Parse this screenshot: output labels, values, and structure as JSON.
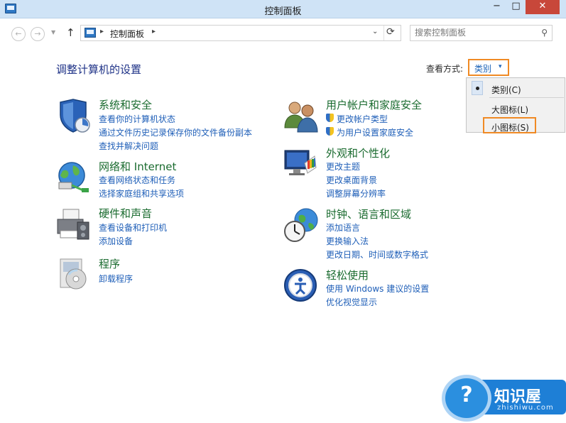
{
  "window": {
    "title": "控制面板",
    "minimize": "−",
    "maximize": "□",
    "close": "✕"
  },
  "nav": {
    "back": "←",
    "forward": "→",
    "recent": "▼",
    "up": "↑",
    "breadcrumb": "控制面板",
    "sep": "▸",
    "dropdown": "⌄",
    "refresh": "⟳",
    "search_placeholder": "搜索控制面板",
    "search_icon": "⚲"
  },
  "content": {
    "heading": "调整计算机的设置",
    "view_by_label": "查看方式:",
    "view_by_value": "类别",
    "view_by_arrow": "▾"
  },
  "view_menu": {
    "items": [
      "类别(C)",
      "大图标(L)",
      "小图标(S)"
    ],
    "selected": "类别(C)",
    "highlighted": "小图标(S)"
  },
  "categories": [
    {
      "title": "系统和安全",
      "icon": "shield-icon",
      "links": [
        "查看你的计算机状态",
        "通过文件历史记录保存你的文件备份副本",
        "查找并解决问题"
      ]
    },
    {
      "title": "网络和 Internet",
      "icon": "network-globe-icon",
      "links": [
        "查看网络状态和任务",
        "选择家庭组和共享选项"
      ]
    },
    {
      "title": "硬件和声音",
      "icon": "printer-icon",
      "links": [
        "查看设备和打印机",
        "添加设备"
      ]
    },
    {
      "title": "程序",
      "icon": "programs-disc-icon",
      "links": [
        "卸载程序"
      ]
    },
    {
      "title": "用户帐户和家庭安全",
      "icon": "users-icon",
      "links": [
        "更改帐户类型",
        "为用户设置家庭安全"
      ]
    },
    {
      "title": "外观和个性化",
      "icon": "monitor-palette-icon",
      "links": [
        "更改主题",
        "更改桌面背景",
        "调整屏幕分辨率"
      ]
    },
    {
      "title": "时钟、语言和区域",
      "icon": "clock-globe-icon",
      "links": [
        "添加语言",
        "更换输入法",
        "更改日期、时间或数字格式"
      ]
    },
    {
      "title": "轻松使用",
      "icon": "ease-of-access-icon",
      "links": [
        "使用 Windows 建议的设置",
        "优化视觉显示"
      ]
    }
  ],
  "watermark": {
    "brand": "知识屋",
    "domain": "zhishiwu.com",
    "glyph": "?"
  },
  "colors": {
    "link": "#1f5fb8",
    "category_title": "#1a6b2f",
    "heading": "#1e3287",
    "highlight_border": "#f08a24",
    "titlebar": "#cfe3f6"
  }
}
